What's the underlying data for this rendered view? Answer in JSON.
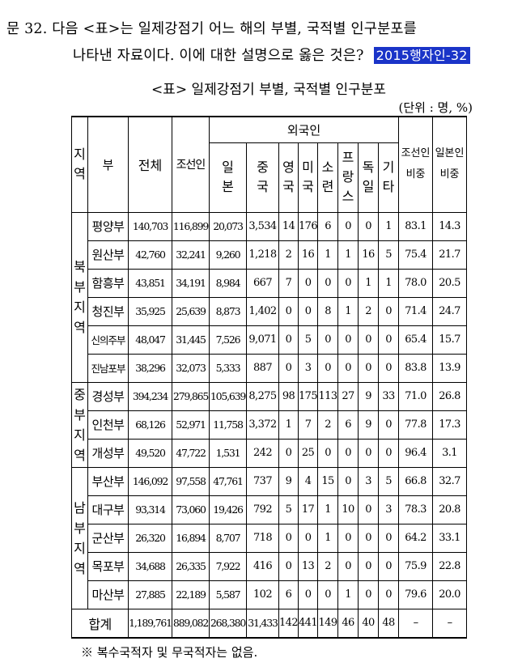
{
  "question": {
    "line1": "문 32. 다음 <표>는 일제강점기 어느 해의 부별, 국적별 인구분포를",
    "line2": "나타낸 자료이다. 이에 대한 설명으로 옳은 것은?",
    "tag": "2015행자인-32"
  },
  "table": {
    "title": "<표> 일제강점기 부별, 국적별 인구분포",
    "unit": "(단위 : 명, %)",
    "headers": {
      "region": "지역",
      "bu": "부",
      "total": "전체",
      "korean": "조선인",
      "foreign": "외국인",
      "japan": "일본",
      "china": "중국",
      "uk": "영국",
      "usa": "미국",
      "ussr": "소련",
      "france": "프랑스",
      "germany": "독일",
      "other": "기타",
      "korean_ratio": "조선인 비중",
      "japanese_ratio": "일본인 비중"
    },
    "regions": [
      {
        "name": "북부지역",
        "rows": [
          {
            "bu": "평양부",
            "total": "140,703",
            "korean": "116,899",
            "japan": "20,073",
            "china": "3,534",
            "uk": "14",
            "usa": "176",
            "ussr": "6",
            "france": "0",
            "germany": "0",
            "other": "1",
            "kr_ratio": "83.1",
            "jp_ratio": "14.3"
          },
          {
            "bu": "원산부",
            "total": "42,760",
            "korean": "32,241",
            "japan": "9,260",
            "china": "1,218",
            "uk": "2",
            "usa": "16",
            "ussr": "1",
            "france": "1",
            "germany": "16",
            "other": "5",
            "kr_ratio": "75.4",
            "jp_ratio": "21.7"
          },
          {
            "bu": "함흥부",
            "total": "43,851",
            "korean": "34,191",
            "japan": "8,984",
            "china": "667",
            "uk": "7",
            "usa": "0",
            "ussr": "0",
            "france": "0",
            "germany": "1",
            "other": "1",
            "kr_ratio": "78.0",
            "jp_ratio": "20.5"
          },
          {
            "bu": "청진부",
            "total": "35,925",
            "korean": "25,639",
            "japan": "8,873",
            "china": "1,402",
            "uk": "0",
            "usa": "0",
            "ussr": "8",
            "france": "1",
            "germany": "2",
            "other": "0",
            "kr_ratio": "71.4",
            "jp_ratio": "24.7"
          },
          {
            "bu": "신의주부",
            "total": "48,047",
            "korean": "31,445",
            "japan": "7,526",
            "china": "9,071",
            "uk": "0",
            "usa": "5",
            "ussr": "0",
            "france": "0",
            "germany": "0",
            "other": "0",
            "kr_ratio": "65.4",
            "jp_ratio": "15.7"
          },
          {
            "bu": "진남포부",
            "total": "38,296",
            "korean": "32,073",
            "japan": "5,333",
            "china": "887",
            "uk": "0",
            "usa": "3",
            "ussr": "0",
            "france": "0",
            "germany": "0",
            "other": "0",
            "kr_ratio": "83.8",
            "jp_ratio": "13.9"
          }
        ]
      },
      {
        "name": "중부지역",
        "rows": [
          {
            "bu": "경성부",
            "total": "394,234",
            "korean": "279,865",
            "japan": "105,639",
            "china": "8,275",
            "uk": "98",
            "usa": "175",
            "ussr": "113",
            "france": "27",
            "germany": "9",
            "other": "33",
            "kr_ratio": "71.0",
            "jp_ratio": "26.8"
          },
          {
            "bu": "인천부",
            "total": "68,126",
            "korean": "52,971",
            "japan": "11,758",
            "china": "3,372",
            "uk": "1",
            "usa": "7",
            "ussr": "2",
            "france": "6",
            "germany": "9",
            "other": "0",
            "kr_ratio": "77.8",
            "jp_ratio": "17.3"
          },
          {
            "bu": "개성부",
            "total": "49,520",
            "korean": "47,722",
            "japan": "1,531",
            "china": "242",
            "uk": "0",
            "usa": "25",
            "ussr": "0",
            "france": "0",
            "germany": "0",
            "other": "0",
            "kr_ratio": "96.4",
            "jp_ratio": "3.1"
          }
        ]
      },
      {
        "name": "남부지역",
        "rows": [
          {
            "bu": "부산부",
            "total": "146,092",
            "korean": "97,558",
            "japan": "47,761",
            "china": "737",
            "uk": "9",
            "usa": "4",
            "ussr": "15",
            "france": "0",
            "germany": "3",
            "other": "5",
            "kr_ratio": "66.8",
            "jp_ratio": "32.7"
          },
          {
            "bu": "대구부",
            "total": "93,314",
            "korean": "73,060",
            "japan": "19,426",
            "china": "792",
            "uk": "5",
            "usa": "17",
            "ussr": "1",
            "france": "10",
            "germany": "0",
            "other": "3",
            "kr_ratio": "78.3",
            "jp_ratio": "20.8"
          },
          {
            "bu": "군산부",
            "total": "26,320",
            "korean": "16,894",
            "japan": "8,707",
            "china": "718",
            "uk": "0",
            "usa": "0",
            "ussr": "1",
            "france": "0",
            "germany": "0",
            "other": "0",
            "kr_ratio": "64.2",
            "jp_ratio": "33.1"
          },
          {
            "bu": "목포부",
            "total": "34,688",
            "korean": "26,335",
            "japan": "7,922",
            "china": "416",
            "uk": "0",
            "usa": "13",
            "ussr": "2",
            "france": "0",
            "germany": "0",
            "other": "0",
            "kr_ratio": "75.9",
            "jp_ratio": "22.8"
          },
          {
            "bu": "마산부",
            "total": "27,885",
            "korean": "22,189",
            "japan": "5,587",
            "china": "102",
            "uk": "6",
            "usa": "0",
            "ussr": "0",
            "france": "1",
            "germany": "0",
            "other": "0",
            "kr_ratio": "79.6",
            "jp_ratio": "20.0"
          }
        ]
      }
    ],
    "total_row": {
      "label": "합계",
      "total": "1,189,761",
      "korean": "889,082",
      "japan": "268,380",
      "china": "31,433",
      "uk": "142",
      "usa": "441",
      "ussr": "149",
      "france": "46",
      "germany": "40",
      "other": "48",
      "kr_ratio": "–",
      "jp_ratio": "–"
    }
  },
  "note": "※  복수국적자 및 무국적자는 없음."
}
